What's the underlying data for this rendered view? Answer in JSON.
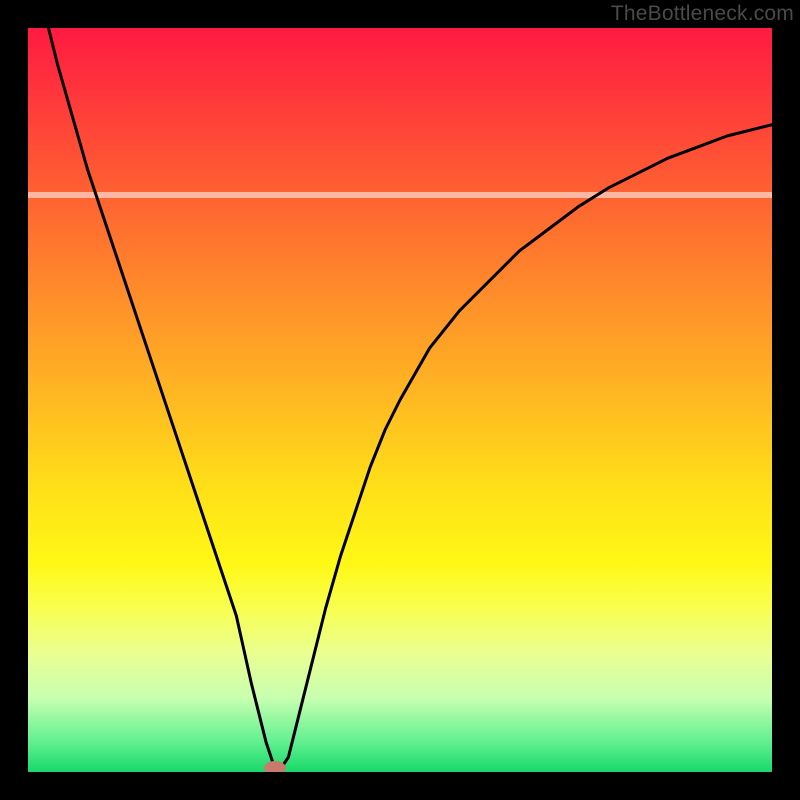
{
  "watermark": "TheBottleneck.com",
  "colors": {
    "background": "#000000",
    "curve": "#000000",
    "marker": "#c97a6e",
    "gradient_top": "#ff1a42",
    "gradient_bottom": "#18d86a"
  },
  "chart_data": {
    "type": "line",
    "title": "",
    "xlabel": "",
    "ylabel": "",
    "xlim": [
      0,
      100
    ],
    "ylim": [
      0,
      100
    ],
    "grid": false,
    "legend": false,
    "x": [
      0,
      2,
      4,
      6,
      8,
      10,
      12,
      14,
      16,
      18,
      20,
      22,
      24,
      26,
      28,
      30,
      31,
      32,
      33,
      34,
      35,
      36,
      38,
      40,
      42,
      44,
      46,
      48,
      50,
      54,
      58,
      62,
      66,
      70,
      74,
      78,
      82,
      86,
      90,
      94,
      98,
      100
    ],
    "y": [
      113,
      103,
      95,
      88,
      81,
      75,
      69,
      63,
      57,
      51,
      45,
      39,
      33,
      27,
      21,
      12,
      8,
      4,
      1,
      0.5,
      2,
      6,
      14,
      22,
      29,
      35,
      41,
      46,
      50,
      57,
      62,
      66,
      70,
      73,
      76,
      78.5,
      80.5,
      82.5,
      84,
      85.5,
      86.5,
      87
    ],
    "marker": {
      "x": 33.2,
      "y": 0.6
    },
    "white_band_y": 78
  }
}
